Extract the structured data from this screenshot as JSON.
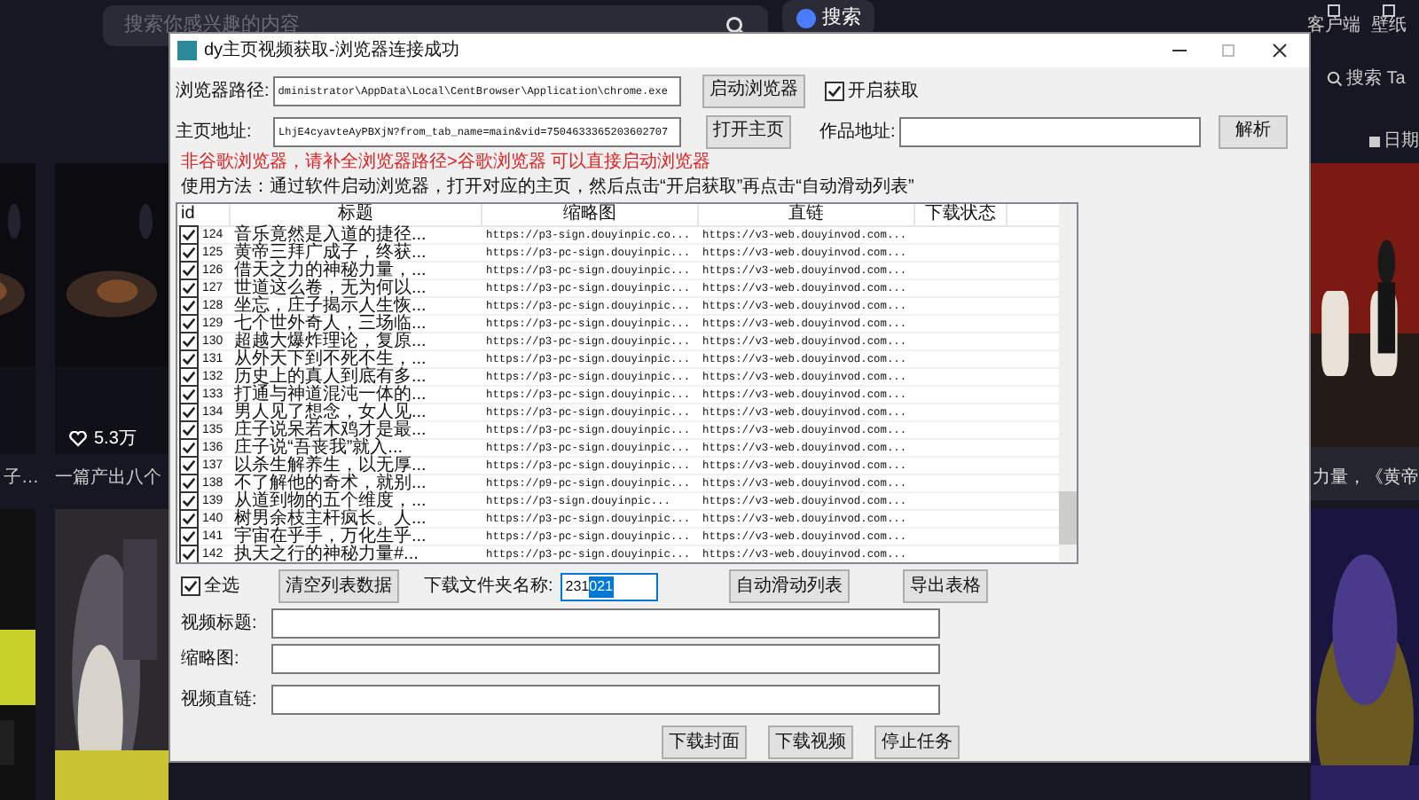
{
  "page": {
    "search": {
      "placeholder": "搜索你感兴趣的内容"
    },
    "ai_button": "搜索",
    "top_links": [
      "客户端",
      "壁纸"
    ],
    "right_search": "搜索 Ta",
    "date_filter": "日期",
    "left_cards": [
      {
        "caption": "子…"
      },
      {
        "likes": "5.3万",
        "caption": "一篇产出八个"
      }
    ],
    "right_card": {
      "caption": "力量，《黄帝"
    }
  },
  "window": {
    "title": "dy主页视频获取-浏览器连接成功",
    "browser_path": {
      "label": "浏览器路径:",
      "value": "dministrator\\AppData\\Local\\CentBrowser\\Application\\chrome.exe"
    },
    "start_browser_button": "启动浏览器",
    "enable_fetch": {
      "label": "开启获取",
      "checked": true
    },
    "homepage": {
      "label": "主页地址:",
      "value": "LhjE4cyavteAyPBXjN?from_tab_name=main&vid=7504633365203602707"
    },
    "open_homepage_button": "打开主页",
    "work_url": {
      "label": "作品地址:"
    },
    "parse_button": "解析",
    "warning": "非谷歌浏览器，请补全浏览器路径>谷歌浏览器 可以直接启动浏览器",
    "usage": "使用方法：通过软件启动浏览器，打开对应的主页，然后点击“开启获取”再点击“自动滑动列表”",
    "table": {
      "columns": [
        "id",
        "标题",
        "缩略图",
        "直链",
        "下载状态"
      ],
      "rows": [
        {
          "checked": true,
          "id": "124",
          "title": "音乐竟然是入道的捷径...",
          "thumbnail": "https://p3-sign.douyinpic.co...",
          "link": "https://v3-web.douyinvod.com..."
        },
        {
          "checked": true,
          "id": "125",
          "title": "黄帝三拜广成子，终获...",
          "thumbnail": "https://p3-pc-sign.douyinpic...",
          "link": "https://v3-web.douyinvod.com..."
        },
        {
          "checked": true,
          "id": "126",
          "title": "借天之力的神秘力量，...",
          "thumbnail": "https://p3-pc-sign.douyinpic...",
          "link": "https://v3-web.douyinvod.com..."
        },
        {
          "checked": true,
          "id": "127",
          "title": "世道这么卷，无为何以...",
          "thumbnail": "https://p3-pc-sign.douyinpic...",
          "link": "https://v3-web.douyinvod.com..."
        },
        {
          "checked": true,
          "id": "128",
          "title": "坐忘，庄子揭示人生恢...",
          "thumbnail": "https://p3-pc-sign.douyinpic...",
          "link": "https://v3-web.douyinvod.com..."
        },
        {
          "checked": true,
          "id": "129",
          "title": "七个世外奇人，三场临...",
          "thumbnail": "https://p3-pc-sign.douyinpic...",
          "link": "https://v3-web.douyinvod.com..."
        },
        {
          "checked": true,
          "id": "130",
          "title": "超越大爆炸理论，复原...",
          "thumbnail": "https://p3-pc-sign.douyinpic...",
          "link": "https://v3-web.douyinvod.com..."
        },
        {
          "checked": true,
          "id": "131",
          "title": "从外天下到不死不生，...",
          "thumbnail": "https://p3-pc-sign.douyinpic...",
          "link": "https://v3-web.douyinvod.com..."
        },
        {
          "checked": true,
          "id": "132",
          "title": "历史上的真人到底有多...",
          "thumbnail": "https://p3-pc-sign.douyinpic...",
          "link": "https://v3-web.douyinvod.com..."
        },
        {
          "checked": true,
          "id": "133",
          "title": "打通与神道混沌一体的...",
          "thumbnail": "https://p3-pc-sign.douyinpic...",
          "link": "https://v3-web.douyinvod.com..."
        },
        {
          "checked": true,
          "id": "134",
          "title": "男人见了想念，女人见...",
          "thumbnail": "https://p3-pc-sign.douyinpic...",
          "link": "https://v3-web.douyinvod.com..."
        },
        {
          "checked": true,
          "id": "135",
          "title": "庄子说呆若木鸡才是最...",
          "thumbnail": "https://p3-pc-sign.douyinpic...",
          "link": "https://v3-web.douyinvod.com..."
        },
        {
          "checked": true,
          "id": "136",
          "title": "庄子说“吾丧我”就入...",
          "thumbnail": "https://p3-pc-sign.douyinpic...",
          "link": "https://v3-web.douyinvod.com..."
        },
        {
          "checked": true,
          "id": "137",
          "title": "以杀生解养生，以无厚...",
          "thumbnail": "https://p3-pc-sign.douyinpic...",
          "link": "https://v3-web.douyinvod.com..."
        },
        {
          "checked": true,
          "id": "138",
          "title": "不了解他的奇术，就别...",
          "thumbnail": "https://p9-pc-sign.douyinpic...",
          "link": "https://v3-web.douyinvod.com..."
        },
        {
          "checked": true,
          "id": "139",
          "title": "从道到物的五个维度，...",
          "thumbnail": "https://p3-sign.douyinpic...",
          "link": "https://v3-web.douyinvod.com..."
        },
        {
          "checked": true,
          "id": "140",
          "title": "树男余枝主杆疯长。人...",
          "thumbnail": "https://p3-pc-sign.douyinpic...",
          "link": "https://v3-web.douyinvod.com..."
        },
        {
          "checked": true,
          "id": "141",
          "title": "宇宙在乎手，万化生乎...",
          "thumbnail": "https://p3-pc-sign.douyinpic...",
          "link": "https://v3-web.douyinvod.com..."
        },
        {
          "checked": true,
          "id": "142",
          "title": "执天之行的神秘力量#...",
          "thumbnail": "https://p3-pc-sign.douyinpic...",
          "link": "https://v3-web.douyinvod.com..."
        }
      ]
    },
    "select_all": {
      "label": "全选",
      "checked": true
    },
    "clear_button": "清空列表数据",
    "folder": {
      "label": "下载文件夹名称:",
      "value": [
        {
          "text": "231",
          "selected": false
        },
        {
          "text": "021",
          "selected": true
        }
      ]
    },
    "auto_scroll_button": "自动滑动列表",
    "export_button": "导出表格",
    "fields": [
      {
        "label": "视频标题:"
      },
      {
        "label": "缩略图:"
      },
      {
        "label": "视频直链:"
      }
    ],
    "actions": [
      "下载封面",
      "下载视频",
      "停止任务"
    ]
  }
}
